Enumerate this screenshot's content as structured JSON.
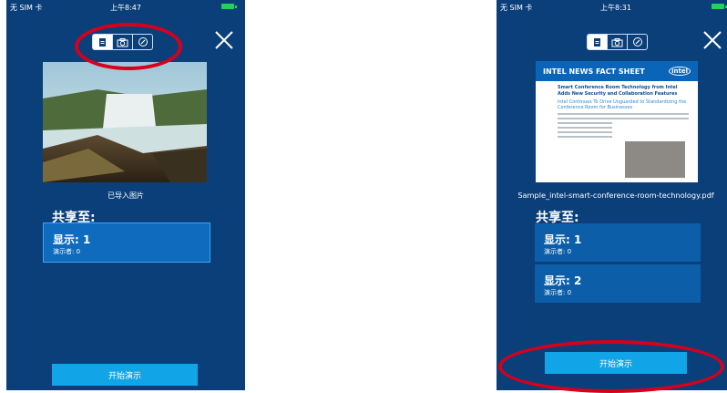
{
  "left_screen": {
    "status": {
      "carrier": "无 SIM 卡",
      "time": "上午8:47"
    },
    "segmented_tabs": [
      "document-icon",
      "camera-icon",
      "compass-icon"
    ],
    "active_tab": 0,
    "preview_caption": "已导入图片",
    "share_heading": "共享至:",
    "displays": [
      {
        "label": "显示: 1",
        "presenters": "演示者: 0",
        "selected": true
      }
    ],
    "start_button": "开始演示"
  },
  "right_screen": {
    "status": {
      "carrier": "无 SIM 卡",
      "time": "上午8:31"
    },
    "segmented_tabs": [
      "document-icon",
      "camera-icon",
      "compass-icon"
    ],
    "active_tab": 0,
    "document_preview": {
      "header": "INTEL NEWS FACT SHEET",
      "logo": "intel",
      "title": "Smart Conference Room Technology from Intel Adds New Security and Collaboration Features",
      "subtitle": "Intel Continues To Drive Unguarded to Standardizing the Conference Room for Businesses"
    },
    "file_name": "Sample_intel-smart-conference-room-technology.pdf",
    "share_heading": "共享至:",
    "displays": [
      {
        "label": "显示: 1",
        "presenters": "演示者: 0",
        "selected": false
      },
      {
        "label": "显示: 2",
        "presenters": "演示者: 0",
        "selected": false
      }
    ],
    "start_button": "开始演示"
  },
  "annotation_color": "#d6001c",
  "colors": {
    "background": "#0b3f7a",
    "card": "#0d5ea8",
    "button": "#11a5e8"
  }
}
